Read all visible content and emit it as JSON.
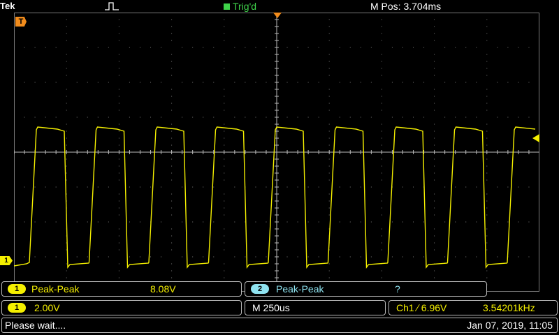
{
  "header": {
    "brand": "Tek",
    "trigger_status": "Trig'd",
    "m_pos": "M Pos: 3.704ms"
  },
  "markers": {
    "trigger": "T",
    "channel": "1"
  },
  "measurements": [
    {
      "channel": "1",
      "label": "Peak-Peak",
      "value": "8.08V"
    },
    {
      "channel": "2",
      "label": "Peak-Peak",
      "value": "?"
    }
  ],
  "status": {
    "ch_badge": "1",
    "ch_scale": "2.00V",
    "timebase": "M 250us",
    "trigger_info": "Ch1 ∕ 6.96V",
    "frequency": "3.54201kHz"
  },
  "footer": {
    "message": "Please wait....",
    "datetime": "Jan 07, 2019, 11:05"
  },
  "colors": {
    "ch1": "#f5f000",
    "ch2": "#8fe3f0",
    "trigger": "#f28c1c",
    "trig_status": "#3fd34a",
    "grid": "#7a7a7a"
  }
}
